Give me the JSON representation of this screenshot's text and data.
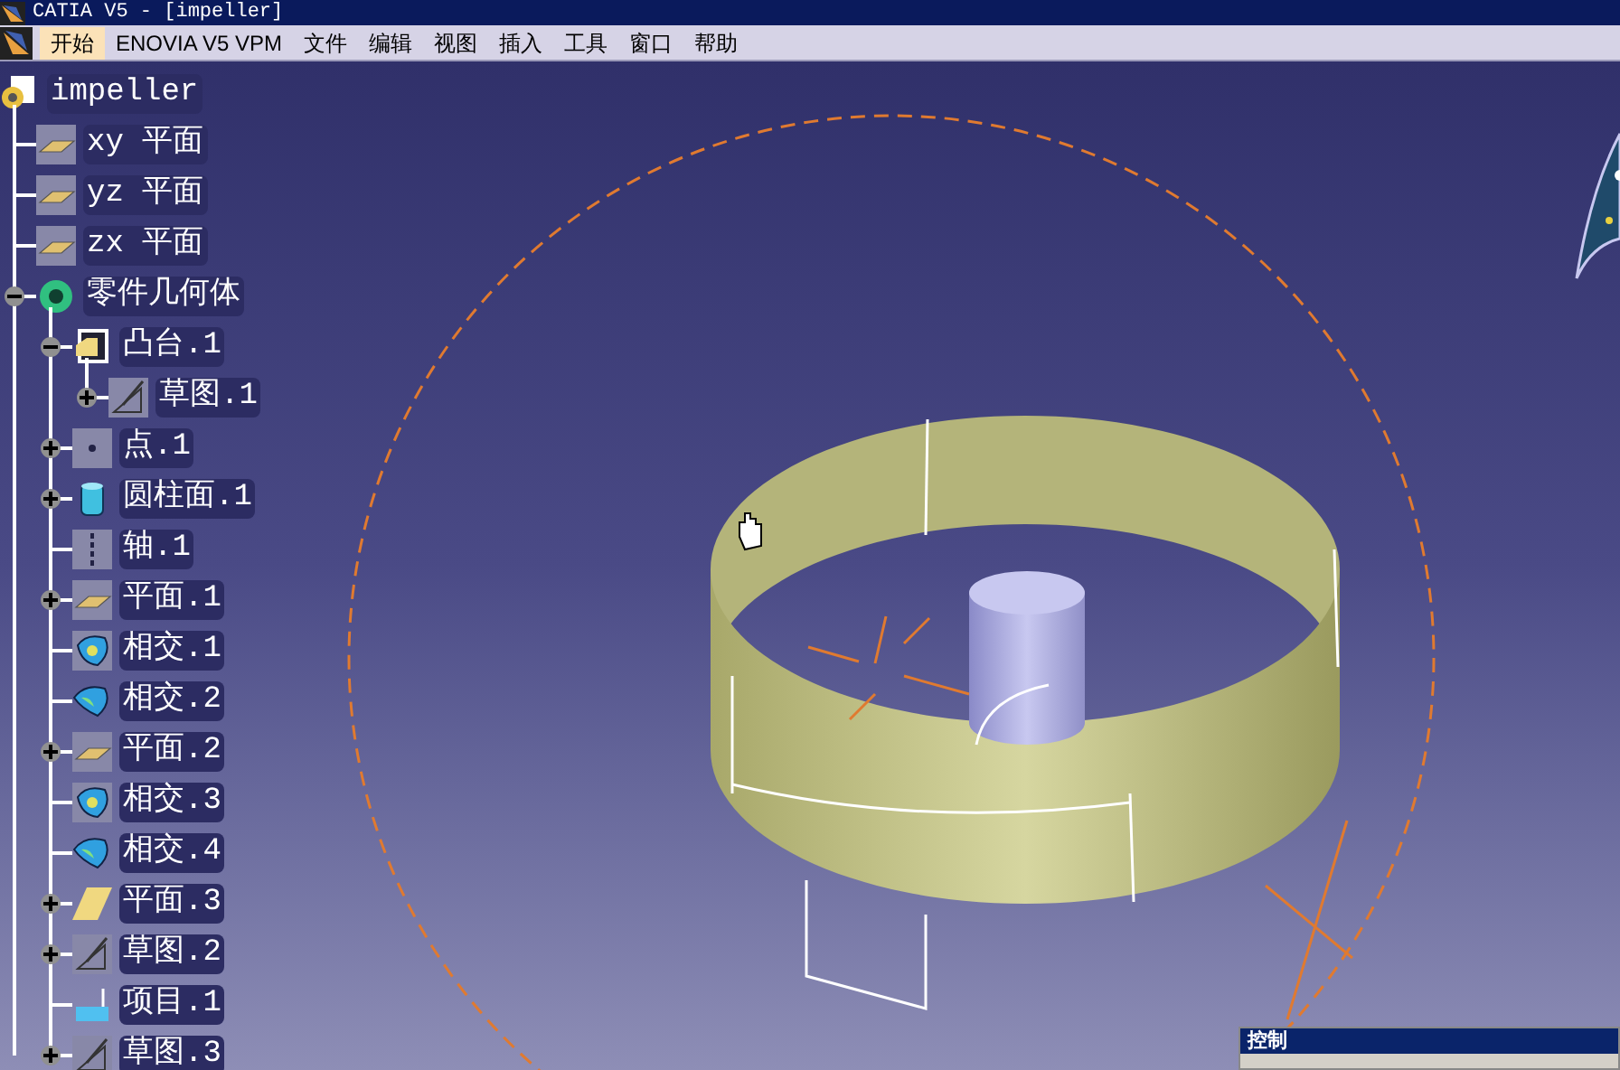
{
  "window": {
    "title": "CATIA V5 - [impeller]"
  },
  "menu": [
    {
      "label": "开始",
      "selected": true
    },
    {
      "label": "ENOVIA V5 VPM",
      "selected": false
    },
    {
      "label": "文件",
      "selected": false
    },
    {
      "label": "编辑",
      "selected": false
    },
    {
      "label": "视图",
      "selected": false
    },
    {
      "label": "插入",
      "selected": false
    },
    {
      "label": "工具",
      "selected": false
    },
    {
      "label": "窗口",
      "selected": false
    },
    {
      "label": "帮助",
      "selected": false
    }
  ],
  "tree": {
    "label": "impeller",
    "kind": "part",
    "children": [
      {
        "label": "xy 平面",
        "kind": "plane"
      },
      {
        "label": "yz 平面",
        "kind": "plane"
      },
      {
        "label": "zx 平面",
        "kind": "plane"
      },
      {
        "label": "零件几何体",
        "kind": "body",
        "expanded": true,
        "children": [
          {
            "label": "凸台.1",
            "kind": "pad",
            "expanded": true,
            "children": [
              {
                "label": "草图.1",
                "kind": "sketch",
                "expanded": false
              }
            ]
          },
          {
            "label": "点.1",
            "kind": "point",
            "expanded": false
          },
          {
            "label": "圆柱面.1",
            "kind": "cylinder",
            "expanded": false
          },
          {
            "label": "轴.1",
            "kind": "axis"
          },
          {
            "label": "平面.1",
            "kind": "plane",
            "expanded": false
          },
          {
            "label": "相交.1",
            "kind": "intersect"
          },
          {
            "label": "相交.2",
            "kind": "surface"
          },
          {
            "label": "平面.2",
            "kind": "plane",
            "expanded": false
          },
          {
            "label": "相交.3",
            "kind": "intersect"
          },
          {
            "label": "相交.4",
            "kind": "surface"
          },
          {
            "label": "平面.3",
            "kind": "planesolid",
            "expanded": false
          },
          {
            "label": "草图.2",
            "kind": "sketch",
            "expanded": false
          },
          {
            "label": "项目.1",
            "kind": "project"
          },
          {
            "label": "草图.3",
            "kind": "sketch",
            "expanded": false
          }
        ]
      }
    ]
  },
  "toolbar": {
    "title": "控制"
  }
}
